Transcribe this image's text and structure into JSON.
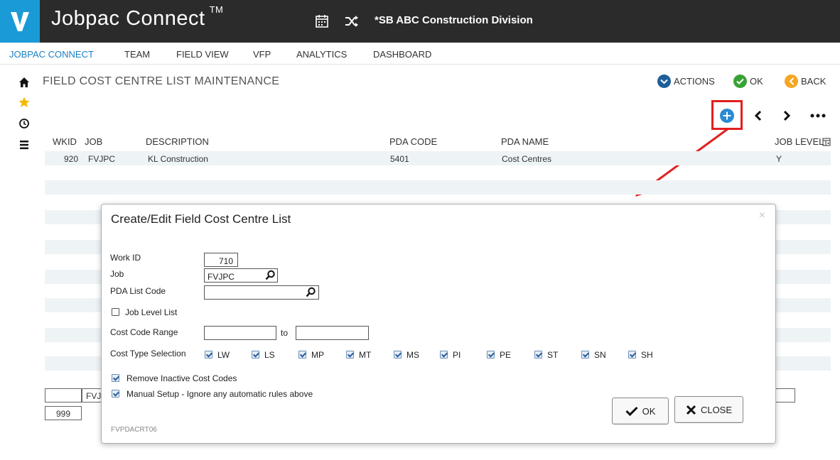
{
  "header": {
    "logo_letter": "V",
    "app_title": "Jobpac Connect",
    "trademark": "TM",
    "division": "*SB ABC Construction Division"
  },
  "nav": {
    "items": [
      "JOBPAC CONNECT",
      "TEAM",
      "FIELD VIEW",
      "VFP",
      "ANALYTICS",
      "DASHBOARD"
    ],
    "active_index": 0
  },
  "page": {
    "title": "FIELD COST CENTRE LIST MAINTENANCE",
    "actions_label": "ACTIONS",
    "ok_label": "OK",
    "back_label": "BACK"
  },
  "table": {
    "columns": [
      "WKID",
      "JOB",
      "DESCRIPTION",
      "PDA CODE",
      "PDA NAME",
      "JOB LEVEL"
    ],
    "rows": [
      {
        "wkid": "920",
        "job": "FVJPC",
        "description": "KL Construction",
        "pda_code": "5401",
        "pda_name": "Cost Centres",
        "job_level": "Y"
      }
    ]
  },
  "background_form": {
    "job_fragment": "FVJ",
    "value_999": "999"
  },
  "modal": {
    "title": "Create/Edit Field Cost Centre List",
    "close_x": "×",
    "work_id_label": "Work ID",
    "work_id_value": "710",
    "job_label": "Job",
    "job_value": "FVJPC",
    "pda_list_code_label": "PDA List Code",
    "pda_list_code_value": "",
    "job_level_list_label": "Job Level List",
    "cost_code_range_label": "Cost Code Range",
    "range_from_value": "",
    "to_label": "to",
    "range_to_value": "",
    "cost_type_selection_label": "Cost Type Selection",
    "cost_types": [
      "LW",
      "LS",
      "MP",
      "MT",
      "MS",
      "PI",
      "PE",
      "ST",
      "SN",
      "SH"
    ],
    "remove_inactive_label": "Remove Inactive Cost Codes",
    "manual_setup_label": "Manual Setup - Ignore any automatic rules above",
    "ok_label": "OK",
    "close_label": "CLOSE",
    "form_id": "FVPDACRT06"
  },
  "colors": {
    "header_bg": "#2b2b2b",
    "logo_blue": "#1a9ad6",
    "nav_active": "#1a7fc1",
    "ok_green": "#3aa235",
    "back_orange": "#f5a623",
    "add_blue": "#2a8ad4",
    "highlight_red": "#e21f1f"
  }
}
